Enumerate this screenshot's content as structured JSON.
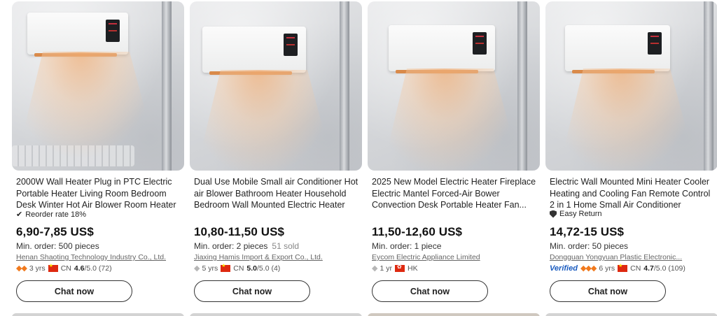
{
  "products": [
    {
      "title": "2000W Wall Heater Plug in PTC Electric Portable Heater Living Room Bedroom Desk Winter Hot Air Blower Room Heater",
      "tag": {
        "icon": "checkmark-icon",
        "text": "Reorder rate 18%"
      },
      "price": "6,90-7,85 US$",
      "moq": "Min. order: 500 pieces",
      "sold": "",
      "supplier": "Henan Shaoting Technology Industry Co., Ltd.",
      "verified": "",
      "supplier_badge": "gold-diamonds-icon",
      "years": "3 yrs",
      "country": "CN",
      "rating": "4.6",
      "rating_suffix": "/5.0 (72)",
      "chat_label": "Chat now"
    },
    {
      "title": "Dual Use Mobile Small air Conditioner Hot air Blower Bathroom Heater Household Bedroom Wall Mounted Electric Heater",
      "tag": {
        "icon": "",
        "text": ""
      },
      "price": "10,80-11,50 US$",
      "moq": "Min. order: 2 pieces",
      "sold": "51 sold",
      "supplier": "Jiaxing Hamis Import & Export Co., Ltd.",
      "verified": "",
      "supplier_badge": "gray-diamond-icon",
      "years": "5 yrs",
      "country": "CN",
      "rating": "5.0",
      "rating_suffix": "/5.0 (4)",
      "chat_label": "Chat now"
    },
    {
      "title": "2025 New Model Electric Heater Fireplace Electric Mantel Forced-Air Bower Convection Desk Portable Heater Fan...",
      "tag": {
        "icon": "",
        "text": ""
      },
      "price": "11,50-12,60 US$",
      "moq": "Min. order: 1 piece",
      "sold": "",
      "supplier": "Eycom Electric Appliance Limited",
      "verified": "",
      "supplier_badge": "gray-diamond-icon",
      "years": "1 yr",
      "country": "HK",
      "rating": "",
      "rating_suffix": "",
      "chat_label": "Chat now"
    },
    {
      "title": "Electric Wall Mounted Mini Heater Cooler Heating and Cooling Fan Remote Control 2 in 1 Home Small Air Conditioner",
      "tag": {
        "icon": "shield-icon",
        "text": "Easy Return"
      },
      "price": "14,72-15 US$",
      "moq": "Min. order: 50 pieces",
      "sold": "",
      "supplier": "Dongguan Yongyuan Plastic Electronic...",
      "verified": "Verified",
      "supplier_badge": "gold-diamonds-icon",
      "years": "6 yrs",
      "country": "CN",
      "rating": "4.7",
      "rating_suffix": "/5.0 (109)",
      "chat_label": "Chat now"
    }
  ],
  "colors": {
    "accent_diamond": "#f17a1e",
    "verified_blue": "#1a5bbf",
    "flag_red": "#de2910"
  }
}
